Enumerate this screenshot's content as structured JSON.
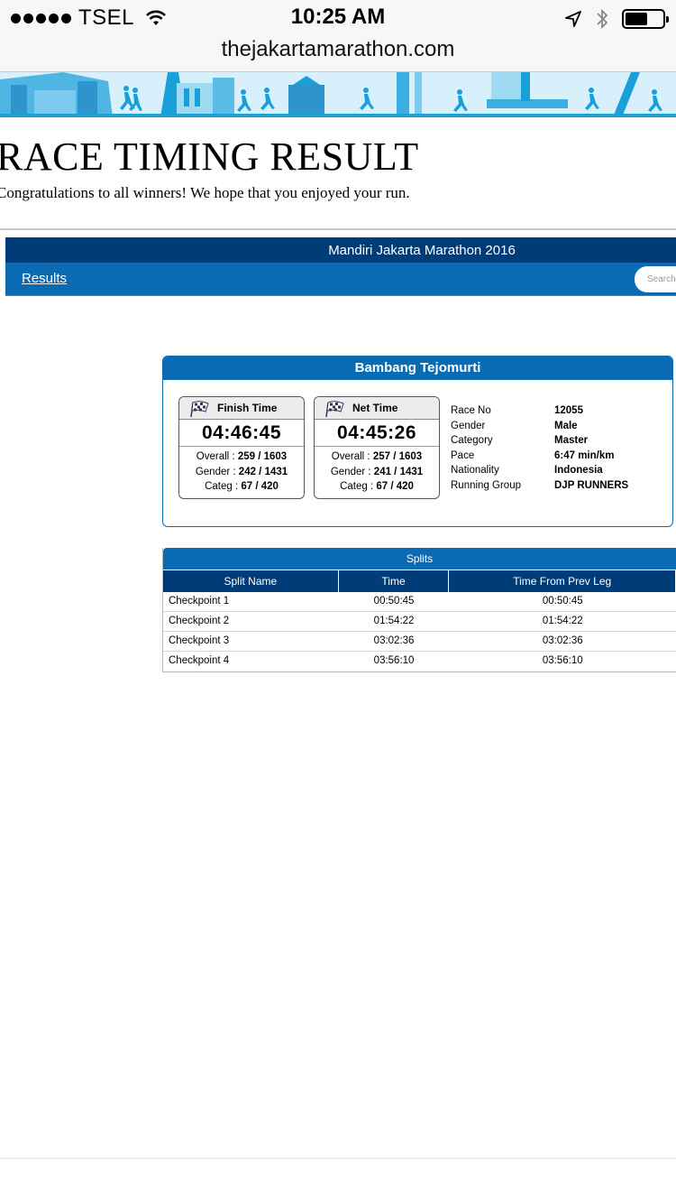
{
  "status_bar": {
    "carrier": "TSEL",
    "time": "10:25 AM"
  },
  "browser": {
    "url": "thejakartamarathon.com"
  },
  "page": {
    "title": "RACE TIMING RESULT",
    "subtitle": "Congratulations to all winners! We hope that you enjoyed your run."
  },
  "event": {
    "name": "Mandiri Jakarta Marathon 2016",
    "nav_results": "Results",
    "search_placeholder": "Search"
  },
  "athlete": {
    "name": "Bambang Tejomurti",
    "finish": {
      "label": "Finish Time",
      "time": "04:46:45",
      "overall_label": "Overall :",
      "overall": "259 / 1603",
      "gender_label": "Gender :",
      "gender": "242 / 1431",
      "categ_label": "Categ :",
      "categ": "67 / 420"
    },
    "net": {
      "label": "Net Time",
      "time": "04:45:26",
      "overall_label": "Overall :",
      "overall": "257 / 1603",
      "gender_label": "Gender :",
      "gender": "241 / 1431",
      "categ_label": "Categ :",
      "categ": "67 / 420"
    },
    "info": [
      {
        "label": "Race No",
        "value": "12055"
      },
      {
        "label": "Gender",
        "value": "Male"
      },
      {
        "label": "Category",
        "value": "Master"
      },
      {
        "label": "Pace",
        "value": "6:47 min/km"
      },
      {
        "label": "Nationality",
        "value": "Indonesia"
      },
      {
        "label": "Running Group",
        "value": "DJP RUNNERS"
      }
    ]
  },
  "splits": {
    "title": "Splits",
    "columns": [
      "Split Name",
      "Time",
      "Time From Prev Leg"
    ],
    "rows": [
      [
        "Checkpoint 1",
        "00:50:45",
        "00:50:45"
      ],
      [
        "Checkpoint 2",
        "01:54:22",
        "01:54:22"
      ],
      [
        "Checkpoint 3",
        "03:02:36",
        "03:02:36"
      ],
      [
        "Checkpoint 4",
        "03:56:10",
        "03:56:10"
      ]
    ]
  },
  "colors": {
    "dark_blue": "#003d78",
    "blue": "#0a6bb3",
    "banner_blue": "#1aa0d8"
  }
}
